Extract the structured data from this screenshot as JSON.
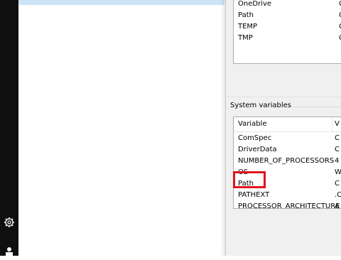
{
  "user_variables": {
    "rows": [
      {
        "name": "OneDrive",
        "value": "C"
      },
      {
        "name": "Path",
        "value": "C"
      },
      {
        "name": "TEMP",
        "value": "C"
      },
      {
        "name": "TMP",
        "value": "C"
      }
    ]
  },
  "system_variables": {
    "group_label": "System variables",
    "columns": {
      "variable": "Variable",
      "value": "V"
    },
    "rows": [
      {
        "name": "ComSpec",
        "value": "C"
      },
      {
        "name": "DriverData",
        "value": "C"
      },
      {
        "name": "NUMBER_OF_PROCESSORS",
        "value": "4"
      },
      {
        "name": "OS",
        "value": "W"
      },
      {
        "name": "Path",
        "value": "C"
      },
      {
        "name": "PATHEXT",
        "value": ".C"
      },
      {
        "name": "PROCESSOR_ARCHITECTURE",
        "value": "A"
      }
    ],
    "highlighted_row": "Path"
  },
  "colors": {
    "highlight_annotation": "#e0141e",
    "taskbar": "#0f0f0f",
    "selection_strip": "#cce4f7"
  },
  "icons": {
    "settings": "gear-icon",
    "user": "user-icon"
  }
}
